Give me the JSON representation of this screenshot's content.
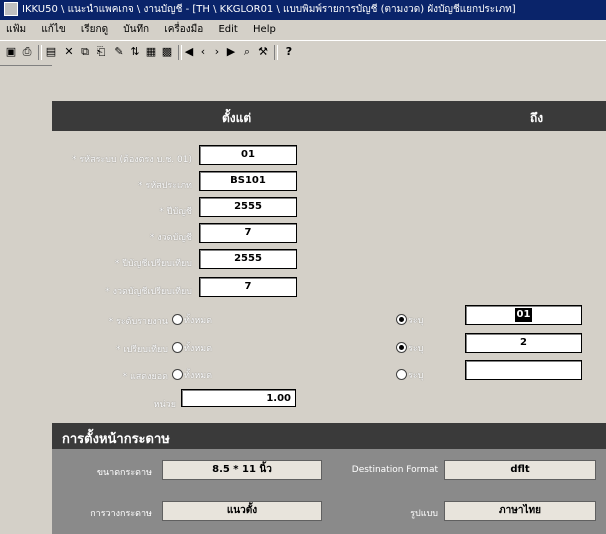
{
  "window": {
    "title": "IKKU50 \\ แนะนำแพคเกจ \\ งานบัญชี - [TH \\ KKGLOR01 \\ แบบพิมพ์รายการบัญชี (ตามงวด) ผังบัญชีแยกประเภท]"
  },
  "menu": {
    "items": [
      "แฟ้ม",
      "แก้ไข",
      "เรียกดู",
      "บันทึก",
      "เครื่องมือ",
      "Edit",
      "Help"
    ]
  },
  "form": {
    "header_from": "ตั้งแต่",
    "header_to": "ถึง",
    "rows": [
      {
        "label": "* รหัสระบบ (ต้องตรง บ.ช. 01)",
        "value": "01"
      },
      {
        "label": "* รหัสประเภท",
        "value": "BS101"
      },
      {
        "label": "* ปีบัญชี",
        "value": "2555"
      },
      {
        "label": "* งวดบัญชี",
        "value": "7"
      },
      {
        "label": "* ปีบัญชีเปรียบเทียบ",
        "value": "2555"
      },
      {
        "label": "* งวดบัญชีเปรียบเทียบ",
        "value": "7"
      }
    ],
    "options": [
      {
        "label": "* ระดับรายงาน",
        "left_option": "ทั้งหมด",
        "right_option": "ระบุ",
        "right_value": "01"
      },
      {
        "label": "* เปรียบเทียบ",
        "left_option": "ทั้งหมด",
        "right_option": "ระบุ",
        "right_value": "2"
      },
      {
        "label": "* แสดงยอด",
        "left_option": "ทั้งหมด",
        "right_option": "ระบุ",
        "right_value": ""
      }
    ],
    "unit_label": "หน่วย",
    "unit_value": "1.00"
  },
  "page_setup": {
    "title": "การตั้งหน้ากระดาษ",
    "paper_size_label": "ขนาดกระดาษ",
    "paper_size_value": "8.5 * 11 นิ้ว",
    "destination_label": "Destination Format",
    "destination_value": "dflt",
    "orientation_label": "การวางกระดาษ",
    "orientation_value": "แนวตั้ง",
    "format_label": "รูปแบบ",
    "format_value": "ภาษาไทย"
  },
  "colors": {
    "titlebar": "#0a246a",
    "header_bar": "#3a3a3a",
    "form_bg": "#d4d0c8"
  }
}
